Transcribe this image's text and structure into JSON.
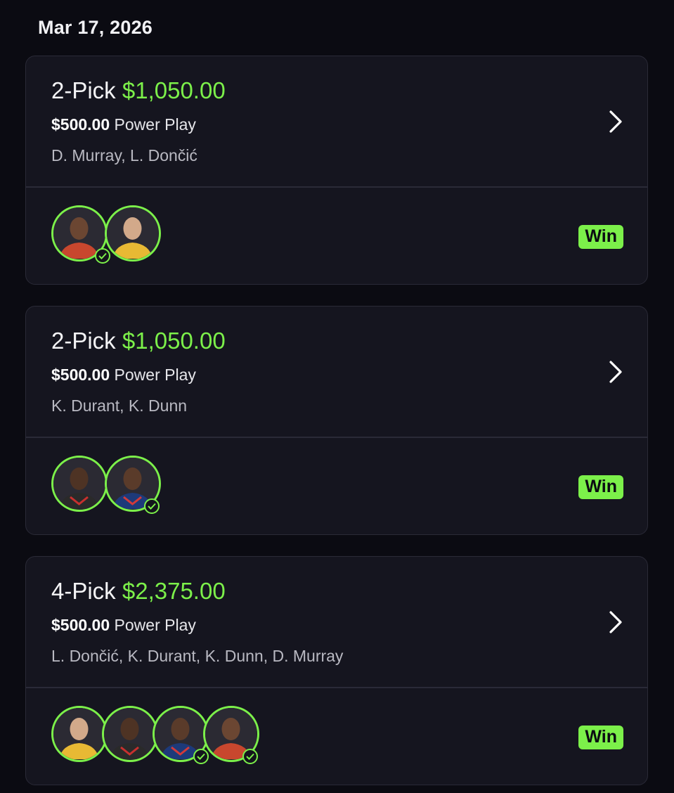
{
  "date": "Mar 17, 2026",
  "colors": {
    "accent": "#7cf04a",
    "background": "#0b0b12",
    "card": "#15151f"
  },
  "cards": [
    {
      "pick_label": "2-Pick",
      "payout": "$1,050.00",
      "stake": "$500.00",
      "play_type": "Power Play",
      "players": "D. Murray, L. Dončić",
      "status": "Win",
      "avatars": [
        {
          "player": "D. Murray",
          "checked": true
        },
        {
          "player": "L. Dončić",
          "checked": false
        }
      ]
    },
    {
      "pick_label": "2-Pick",
      "payout": "$1,050.00",
      "stake": "$500.00",
      "play_type": "Power Play",
      "players": "K. Durant, K. Dunn",
      "status": "Win",
      "avatars": [
        {
          "player": "K. Durant",
          "checked": false
        },
        {
          "player": "K. Dunn",
          "checked": true
        }
      ]
    },
    {
      "pick_label": "4-Pick",
      "payout": "$2,375.00",
      "stake": "$500.00",
      "play_type": "Power Play",
      "players": "L. Dončić, K. Durant, K. Dunn, D. Murray",
      "status": "Win",
      "avatars": [
        {
          "player": "L. Dončić",
          "checked": false
        },
        {
          "player": "K. Durant",
          "checked": false
        },
        {
          "player": "K. Dunn",
          "checked": true
        },
        {
          "player": "D. Murray",
          "checked": true
        }
      ]
    }
  ]
}
